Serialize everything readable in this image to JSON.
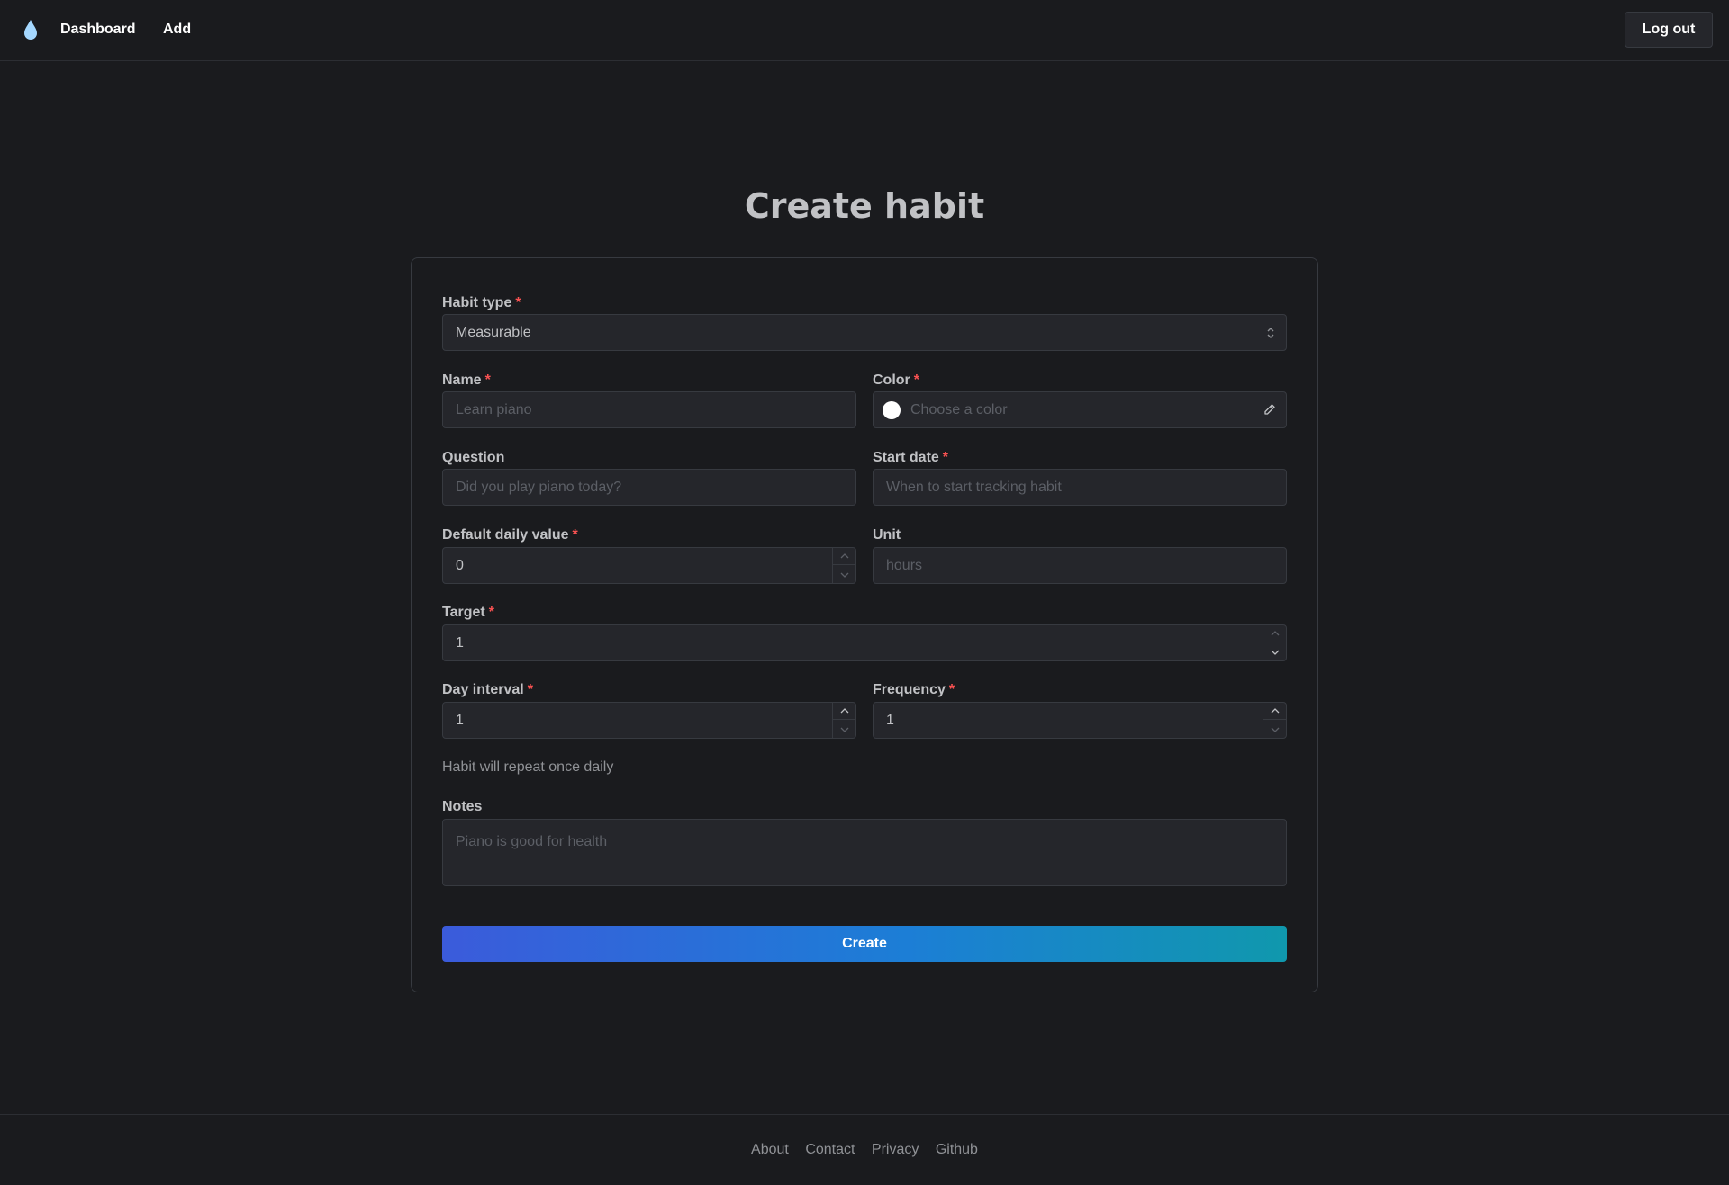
{
  "header": {
    "logo_icon": "droplet-icon",
    "nav": {
      "dashboard": "Dashboard",
      "add": "Add"
    },
    "logout_label": "Log out"
  },
  "page": {
    "title": "Create habit"
  },
  "form": {
    "required_marker": "*",
    "habit_type": {
      "label": "Habit type",
      "value": "Measurable"
    },
    "name": {
      "label": "Name",
      "placeholder": "Learn piano"
    },
    "color": {
      "label": "Color",
      "placeholder": "Choose a color",
      "swatch": "#ffffff"
    },
    "question": {
      "label": "Question",
      "placeholder": "Did you play piano today?"
    },
    "start_date": {
      "label": "Start date",
      "placeholder": "When to start tracking habit"
    },
    "default_daily_value": {
      "label": "Default daily value",
      "value": "0"
    },
    "unit": {
      "label": "Unit",
      "placeholder": "hours"
    },
    "target": {
      "label": "Target",
      "value": "1"
    },
    "day_interval": {
      "label": "Day interval",
      "value": "1"
    },
    "frequency": {
      "label": "Frequency",
      "value": "1"
    },
    "repeat_hint": "Habit will repeat once daily",
    "notes": {
      "label": "Notes",
      "placeholder": "Piano is good for health"
    },
    "submit_label": "Create"
  },
  "footer": {
    "links": [
      "About",
      "Contact",
      "Privacy",
      "Github"
    ]
  },
  "colors": {
    "background": "#1a1b1e",
    "input_bg": "#25262b",
    "border": "#373a40",
    "required": "#fa5252",
    "accent_gradient_start": "#3b5bdb",
    "accent_gradient_end": "#1098ad",
    "logo": "#a5d8ff"
  }
}
